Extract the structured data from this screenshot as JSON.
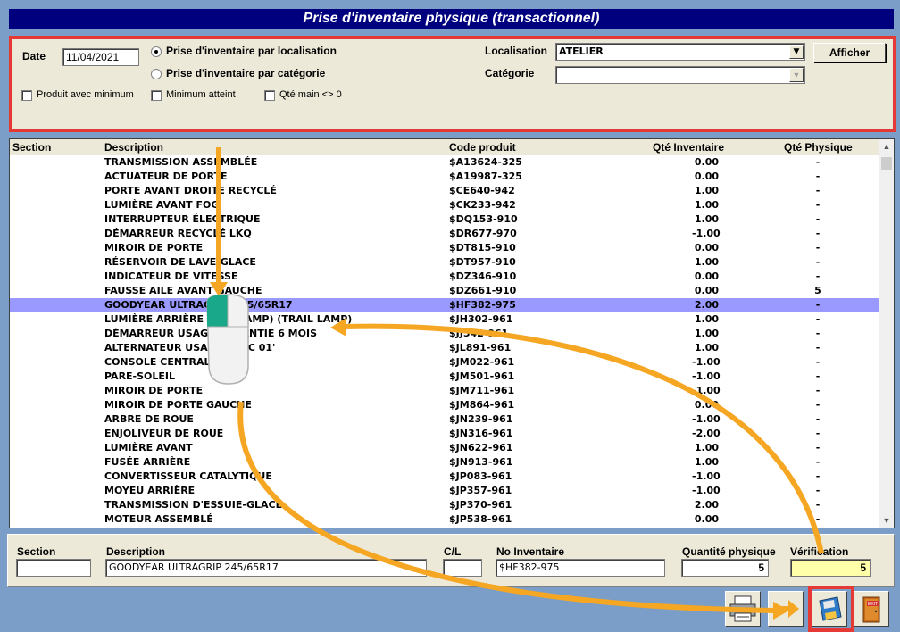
{
  "window": {
    "title": "Prise d'inventaire physique (transactionnel)"
  },
  "filters": {
    "date_label": "Date",
    "date_value": "11/04/2021",
    "radio_localisation": "Prise d'inventaire par localisation",
    "radio_categorie": "Prise d'inventaire par catégorie",
    "check_produit_min": "Produit avec minimum",
    "check_min_atteint": "Minimum atteint",
    "check_qte_main": "Qté main <> 0",
    "localisation_label": "Localisation",
    "localisation_value": "ATELIER",
    "categorie_label": "Catégorie",
    "categorie_value": "",
    "afficher_label": "Afficher"
  },
  "grid": {
    "headers": [
      "Section",
      "Description",
      "Code produit",
      "Qté Inventaire",
      "Qté Physique"
    ],
    "selected_index": 10,
    "rows": [
      {
        "desc": "TRANSMISSION ASSEMBLÉE",
        "code": "$A13624-325",
        "inv": "0.00",
        "phys": "-"
      },
      {
        "desc": "ACTUATEUR DE PORTE",
        "code": "$A19987-325",
        "inv": "0.00",
        "phys": "-"
      },
      {
        "desc": "PORTE AVANT DROITE RECYCLÉ",
        "code": "$CE640-942",
        "inv": "1.00",
        "phys": "-"
      },
      {
        "desc": "LUMIÈRE AVANT FOG",
        "code": "$CK233-942",
        "inv": "1.00",
        "phys": "-"
      },
      {
        "desc": "INTERRUPTEUR ÉLECTRIQUE",
        "code": "$DQ153-910",
        "inv": "1.00",
        "phys": "-"
      },
      {
        "desc": "DÉMARREUR RECYCLÉ LKQ",
        "code": "$DR677-970",
        "inv": "-1.00",
        "phys": "-"
      },
      {
        "desc": "MIROIR DE PORTE",
        "code": "$DT815-910",
        "inv": "0.00",
        "phys": "-"
      },
      {
        "desc": "RÉSERVOIR DE LAVE-GLACE",
        "code": "$DT957-910",
        "inv": "1.00",
        "phys": "-"
      },
      {
        "desc": "INDICATEUR DE VITESSE",
        "code": "$DZ346-910",
        "inv": "0.00",
        "phys": "-"
      },
      {
        "desc": "FAUSSE AILE AVANT GAUCHE",
        "code": "$DZ661-910",
        "inv": "0.00",
        "phys": "5"
      },
      {
        "desc": "GOODYEAR ULTRAGRIP 245/65R17",
        "code": "$HF382-975",
        "inv": "2.00",
        "phys": "-"
      },
      {
        "desc": "LUMIÈRE ARRIÈRE (TAIL LAMP) (TRAIL LAMP)",
        "code": "$JH302-961",
        "inv": "1.00",
        "phys": "-"
      },
      {
        "desc": "DÉMARREUR USAGÉ GARANTIE 6 MOIS",
        "code": "$JJ542-961",
        "inv": "1.00",
        "phys": "-"
      },
      {
        "desc": "ALTERNATEUR USAGÉ CIVIC 01'",
        "code": "$JL891-961",
        "inv": "1.00",
        "phys": "-"
      },
      {
        "desc": "CONSOLE CENTRALE",
        "code": "$JM022-961",
        "inv": "-1.00",
        "phys": "-"
      },
      {
        "desc": "PARE-SOLEIL",
        "code": "$JM501-961",
        "inv": "-1.00",
        "phys": "-"
      },
      {
        "desc": "MIROIR DE PORTE",
        "code": "$JM711-961",
        "inv": "-1.00",
        "phys": "-"
      },
      {
        "desc": "MIROIR DE PORTE GAUCHE",
        "code": "$JM864-961",
        "inv": "0.00",
        "phys": "-"
      },
      {
        "desc": "ARBRE DE ROUE",
        "code": "$JN239-961",
        "inv": "-1.00",
        "phys": "-"
      },
      {
        "desc": "ENJOLIVEUR DE ROUE",
        "code": "$JN316-961",
        "inv": "-2.00",
        "phys": "-"
      },
      {
        "desc": "LUMIÈRE AVANT",
        "code": "$JN622-961",
        "inv": "1.00",
        "phys": "-"
      },
      {
        "desc": "FUSÉE ARRIÈRE",
        "code": "$JN913-961",
        "inv": "1.00",
        "phys": "-"
      },
      {
        "desc": "CONVERTISSEUR CATALYTIQUE",
        "code": "$JP083-961",
        "inv": "-1.00",
        "phys": "-"
      },
      {
        "desc": "MOYEU ARRIÈRE",
        "code": "$JP357-961",
        "inv": "-1.00",
        "phys": "-"
      },
      {
        "desc": "TRANSMISSION D'ESSUIE-GLACE",
        "code": "$JP370-961",
        "inv": "2.00",
        "phys": "-"
      },
      {
        "desc": "MOTEUR ASSEMBLÉ",
        "code": "$JP538-961",
        "inv": "0.00",
        "phys": "-"
      }
    ]
  },
  "detail": {
    "section_label": "Section",
    "section_value": "",
    "description_label": "Description",
    "description_value": "GOODYEAR ULTRAGRIP 245/65R17",
    "cl_label": "C/L",
    "cl_value": "",
    "no_inventaire_label": "No Inventaire",
    "no_inventaire_value": "$HF382-975",
    "quantite_label": "Quantité physique",
    "quantite_value": "5",
    "verification_label": "Vérification",
    "verification_value": "5"
  },
  "toolbar": {
    "print_icon": "printer-icon",
    "next_icon": "arrow-right-icon",
    "save_icon": "floppy-disk-icon",
    "exit_icon": "exit-door-icon",
    "exit_text": "EXIT"
  },
  "colors": {
    "title_bg": "#00007f",
    "selected_row": "#9999ff",
    "highlight": "#e53935",
    "arrow": "#f5a623",
    "verification_bg": "#ffffaa"
  }
}
